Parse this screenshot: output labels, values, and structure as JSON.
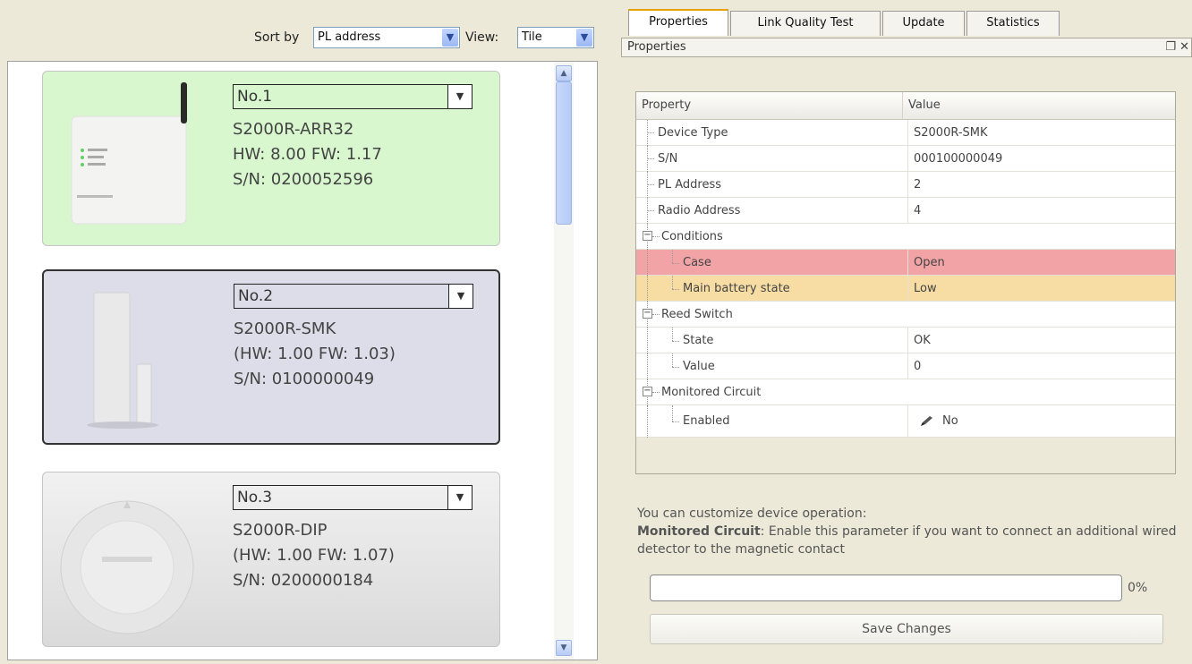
{
  "sort": {
    "label": "Sort by",
    "value": "PL address"
  },
  "view": {
    "label": "View:",
    "value": "Tile"
  },
  "devices": [
    {
      "number": "No.1",
      "model": "S2000R-ARR32",
      "hw_fw": "HW: 8.00 FW: 1.17",
      "sn": "S/N: 0200052596",
      "state": "highlighted-green"
    },
    {
      "number": "No.2",
      "model": "S2000R-SMK",
      "hw_fw": "(HW: 1.00 FW: 1.03)",
      "sn": "S/N: 0100000049",
      "state": "selected"
    },
    {
      "number": "No.3",
      "model": "S2000R-DIP",
      "hw_fw": "(HW: 1.00 FW: 1.07)",
      "sn": "S/N: 0200000184",
      "state": "normal"
    }
  ],
  "tabs": [
    "Properties",
    "Link Quality Test",
    "Update",
    "Statistics"
  ],
  "active_tab": "Properties",
  "panel_title": "Properties",
  "panel_controls": "❐ ✕",
  "grid": {
    "header": {
      "property": "Property",
      "value": "Value"
    },
    "rows": [
      {
        "property": "Device Type",
        "value": "S2000R-SMK"
      },
      {
        "property": "S/N",
        "value": "000100000049"
      },
      {
        "property": "PL Address",
        "value": "2"
      },
      {
        "property": "Radio Address",
        "value": "4"
      },
      {
        "property": "Conditions",
        "value": ""
      },
      {
        "property": "Case",
        "value": "Open"
      },
      {
        "property": "Main battery state",
        "value": "Low"
      },
      {
        "property": "Reed Switch",
        "value": ""
      },
      {
        "property": "State",
        "value": "OK"
      },
      {
        "property": "Value",
        "value": "0"
      },
      {
        "property": "Monitored Circuit",
        "value": ""
      },
      {
        "property": "Enabled",
        "value": "No"
      }
    ]
  },
  "description": {
    "intro": "You can customize device operation:",
    "param_name": "Monitored Circuit",
    "param_text": ": Enable this parameter if you want to connect an additional wired detector to the magnetic contact"
  },
  "progress": {
    "value": 0,
    "label": "0%"
  },
  "save_label": "Save Changes",
  "colors": {
    "case_open": "#f1a3a6",
    "battery_low": "#f7dda3",
    "card_green": "#d9f7cf",
    "card_selected": "#dcdde8"
  }
}
